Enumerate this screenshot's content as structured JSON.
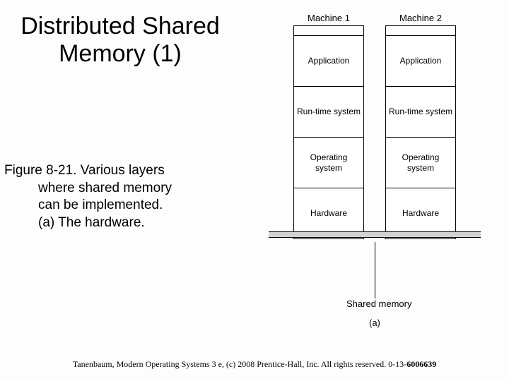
{
  "title": "Distributed Shared Memory (1)",
  "caption": {
    "line1": "Figure 8-21. Various layers",
    "line2": "where shared memory",
    "line3": "can be implemented.",
    "line4": "(a) The hardware."
  },
  "diagram": {
    "machines": [
      {
        "label": "Machine 1",
        "layers": [
          "Application",
          "Run-time system",
          "Operating system",
          "Hardware"
        ]
      },
      {
        "label": "Machine 2",
        "layers": [
          "Application",
          "Run-time system",
          "Operating system",
          "Hardware"
        ]
      }
    ],
    "shared_label": "Shared memory",
    "sub_label": "(a)"
  },
  "footer": {
    "text": "Tanenbaum, Modern Operating Systems 3 e, (c) 2008 Prentice-Hall, Inc. All rights reserved. 0-13-",
    "isbn_last": "6006639"
  }
}
